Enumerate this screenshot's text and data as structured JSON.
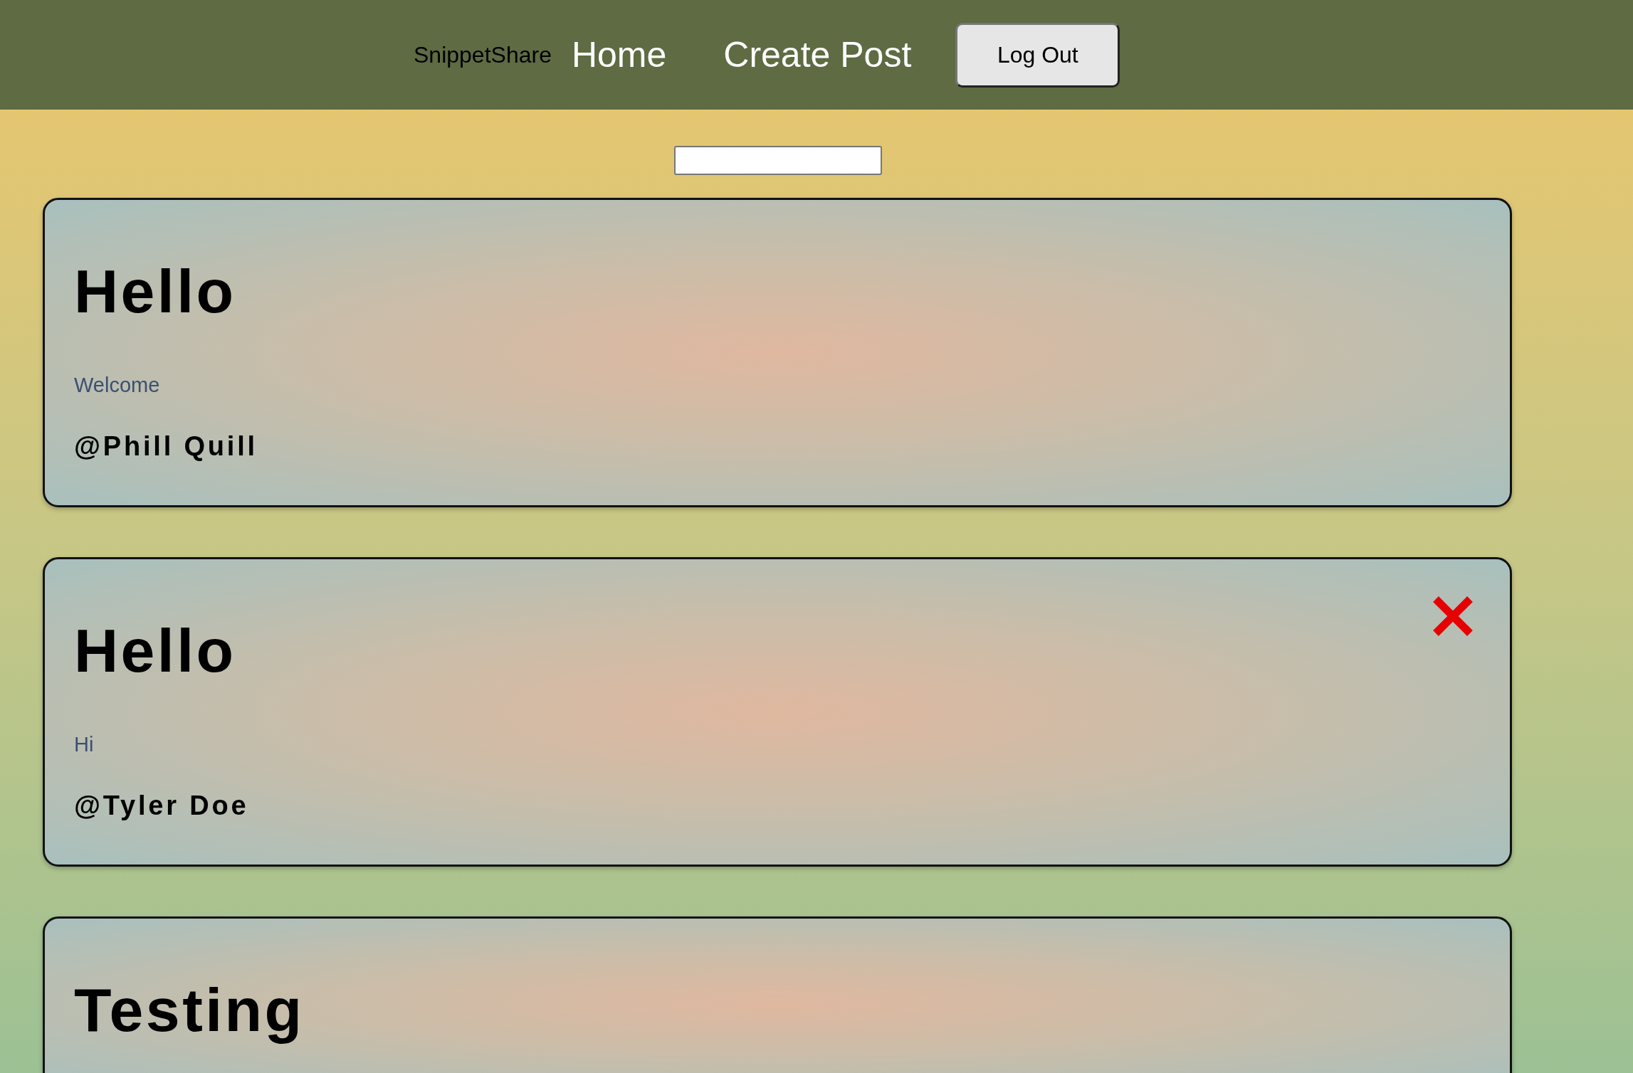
{
  "nav": {
    "brand": "SnippetShare",
    "links": [
      "Home",
      "Create Post"
    ],
    "button": "Log Out"
  },
  "posts": [
    {
      "title": "Hello",
      "body": "Welcome",
      "author": "@Phill Quill",
      "can_delete": false
    },
    {
      "title": "Hello",
      "body": "Hi",
      "author": "@Tyler Doe",
      "can_delete": true
    },
    {
      "title": "Testing",
      "can_delete": false
    }
  ]
}
